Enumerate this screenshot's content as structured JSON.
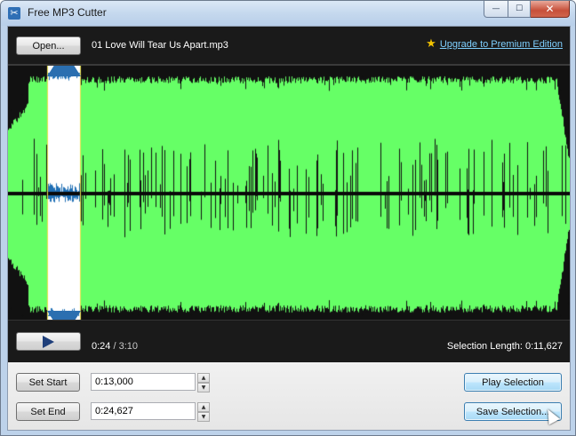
{
  "window": {
    "title": "Free MP3 Cutter",
    "buttons": {
      "minimize": "—",
      "maximize": "☐",
      "close": "✕"
    }
  },
  "topbar": {
    "open_label": "Open...",
    "file_name": "01 Love Will Tear Us Apart.mp3",
    "upgrade_label": "Upgrade to Premium Edition",
    "star_icon": "star-icon"
  },
  "waveform": {
    "colors": {
      "wave": "#66ff66",
      "selection": "#ffffff",
      "selection_wave": "#1f6fb5",
      "handle": "#2b6fb0",
      "center_line": "#0a0a0a"
    },
    "selection": {
      "start_fraction": 0.069,
      "end_fraction": 0.1292
    }
  },
  "transport": {
    "play_icon": "play-icon",
    "position": "0:24",
    "separator": " / ",
    "total": "3:10",
    "selection_length": "Selection Length: 0:11,627"
  },
  "controls": {
    "set_start_label": "Set Start",
    "set_end_label": "Set End",
    "start_value": "0:13,000",
    "end_value": "0:24,627",
    "play_selection_label": "Play Selection",
    "save_selection_label": "Save Selection..."
  }
}
